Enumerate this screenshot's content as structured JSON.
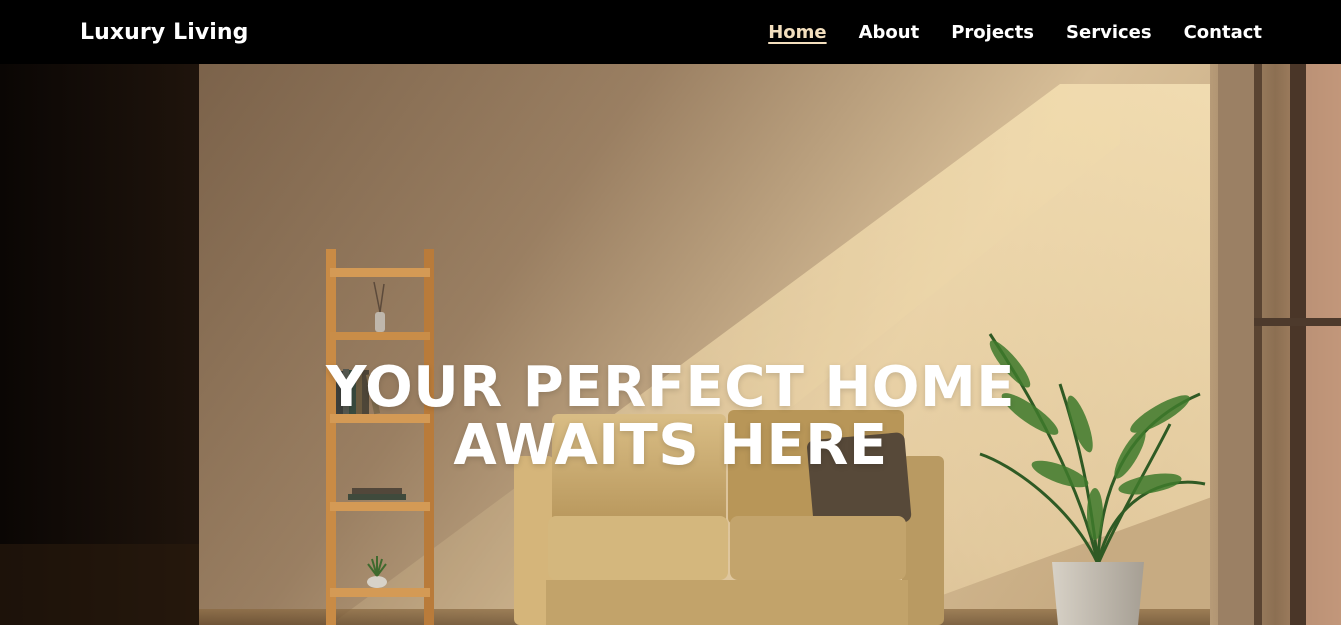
{
  "brand": {
    "name": "Luxury Living"
  },
  "nav": {
    "items": [
      {
        "label": "Home",
        "active": true
      },
      {
        "label": "About",
        "active": false
      },
      {
        "label": "Projects",
        "active": false
      },
      {
        "label": "Services",
        "active": false
      },
      {
        "label": "Contact",
        "active": false
      }
    ]
  },
  "hero": {
    "title_line1": "YOUR PERFECT HOME",
    "title_line2": "AWAITS HERE"
  },
  "colors": {
    "nav_bg": "#000000",
    "active_link": "#f3dfbe",
    "wall": "#c9b08a",
    "sofa": "#c9aa6e"
  }
}
